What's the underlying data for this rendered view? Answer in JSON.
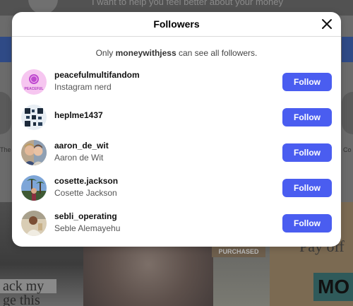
{
  "background": {
    "top_text": "I want to help you feel better about your money",
    "left_side_text": "The",
    "right_side_text": "Co",
    "tile_text_line1": "ack my",
    "tile_text_line2": "ge this",
    "purchased_label": "PURCHASED",
    "right_big_text": "Pay off",
    "right_brand_text": "MO"
  },
  "modal": {
    "title": "Followers",
    "close_icon": "close-icon",
    "notice_prefix": "Only",
    "notice_owner": "moneywithjess",
    "notice_suffix": "can see all followers."
  },
  "followers": [
    {
      "username": "peacefulmultifandom",
      "full_name": "Instagram nerd",
      "button": "Follow",
      "avatar_text": "PEACEFUL",
      "avatar_color": "#f6c6f0"
    },
    {
      "username": "heplme1437",
      "full_name": "",
      "button": "Follow",
      "avatar_color": "#1c2a3a"
    },
    {
      "username": "aaron_de_wit",
      "full_name": "Aaron de Wit",
      "button": "Follow",
      "avatar_color": "#8a6c55"
    },
    {
      "username": "cosette.jackson",
      "full_name": "Cosette Jackson",
      "button": "Follow",
      "avatar_color": "#3a6aa8"
    },
    {
      "username": "sebli_operating",
      "full_name": "Seble Alemayehu",
      "button": "Follow",
      "avatar_color": "#c7b79a"
    }
  ],
  "colors": {
    "accent": "#4a5df0",
    "overlay": "#6b6b6b",
    "modal_bg": "#ffffff"
  }
}
